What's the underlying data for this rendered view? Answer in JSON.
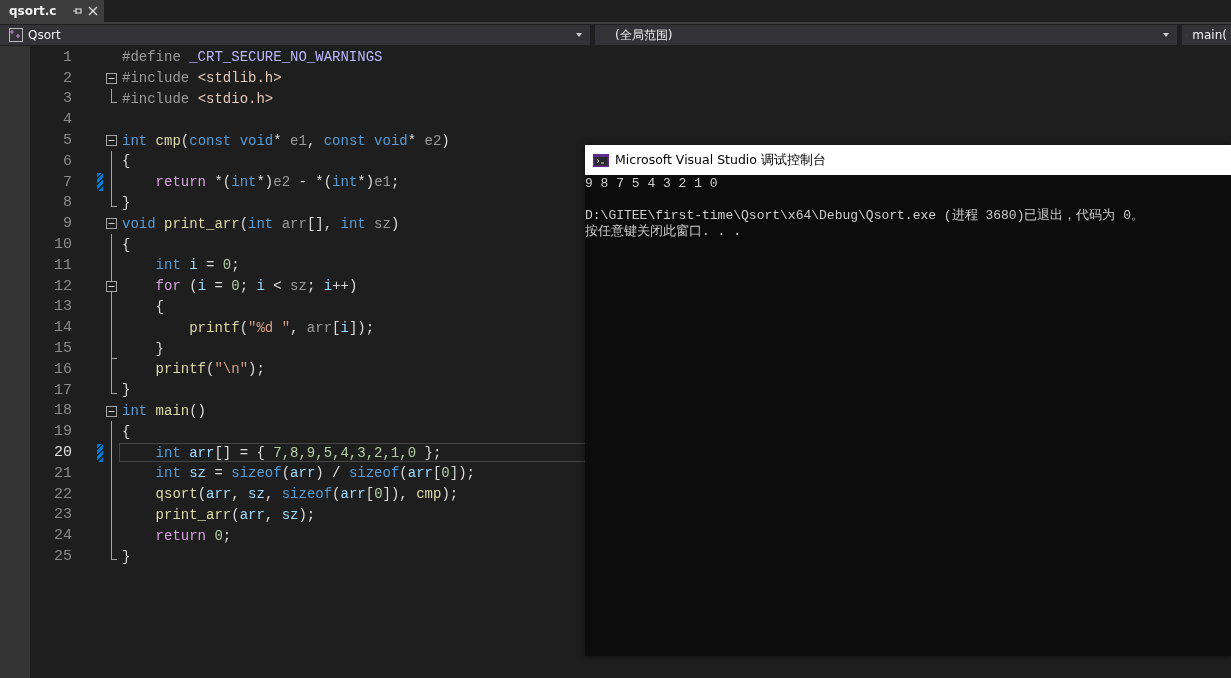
{
  "tabs": [
    {
      "label": "qsort.c",
      "selected": true
    }
  ],
  "navigation_bar": {
    "project": "Qsort",
    "scope": "(全局范围)",
    "member": "main("
  },
  "editor": {
    "lines": [
      {
        "number": "1",
        "collapsible": false,
        "in_region": false,
        "region_end": false,
        "changed": false,
        "current": false,
        "code": [
          {
            "kind": "preprocessor",
            "text": "#define "
          },
          {
            "kind": "macro",
            "text": "_CRT_SECURE_NO_WARNINGS"
          }
        ]
      },
      {
        "number": "2",
        "collapsible": true,
        "in_region": false,
        "region_end": false,
        "changed": false,
        "current": false,
        "code": [
          {
            "kind": "preprocessor",
            "text": "#include "
          },
          {
            "kind": "include",
            "text": "<stdlib.h>"
          }
        ]
      },
      {
        "number": "3",
        "collapsible": false,
        "in_region": false,
        "region_end": true,
        "changed": false,
        "current": false,
        "code": [
          {
            "kind": "preprocessor",
            "text": "#include "
          },
          {
            "kind": "include",
            "text": "<stdio.h>"
          }
        ]
      },
      {
        "number": "4",
        "collapsible": false,
        "in_region": false,
        "region_end": false,
        "changed": false,
        "current": false
      },
      {
        "number": "5",
        "collapsible": true,
        "in_region": false,
        "region_end": false,
        "changed": false,
        "current": false,
        "code": [
          {
            "kind": "keyword",
            "text": "int "
          },
          {
            "kind": "function",
            "text": "cmp"
          },
          {
            "kind": "plain",
            "text": "("
          },
          {
            "kind": "keyword",
            "text": "const void"
          },
          {
            "kind": "plain",
            "text": "* "
          },
          {
            "kind": "parameter",
            "text": "e1"
          },
          {
            "kind": "plain",
            "text": ", "
          },
          {
            "kind": "keyword",
            "text": "const void"
          },
          {
            "kind": "plain",
            "text": "* "
          },
          {
            "kind": "parameter",
            "text": "e2"
          },
          {
            "kind": "plain",
            "text": ")"
          }
        ]
      },
      {
        "number": "6",
        "collapsible": false,
        "in_region": true,
        "region_end": false,
        "changed": false,
        "current": false,
        "code": [
          {
            "kind": "plain",
            "text": "{"
          }
        ]
      },
      {
        "number": "7",
        "collapsible": false,
        "in_region": true,
        "region_end": false,
        "changed": true,
        "current": false,
        "code": [
          {
            "kind": "control",
            "text": "    return"
          },
          {
            "kind": "plain",
            "text": " *("
          },
          {
            "kind": "keyword",
            "text": "int"
          },
          {
            "kind": "plain",
            "text": "*)"
          },
          {
            "kind": "parameter",
            "text": "e2"
          },
          {
            "kind": "plain",
            "text": " - *("
          },
          {
            "kind": "keyword",
            "text": "int"
          },
          {
            "kind": "plain",
            "text": "*)"
          },
          {
            "kind": "parameter",
            "text": "e1"
          },
          {
            "kind": "plain",
            "text": ";"
          }
        ]
      },
      {
        "number": "8",
        "collapsible": false,
        "in_region": false,
        "region_end": true,
        "changed": false,
        "current": false,
        "code": [
          {
            "kind": "plain",
            "text": "}"
          }
        ]
      },
      {
        "number": "9",
        "collapsible": true,
        "in_region": false,
        "region_end": false,
        "changed": false,
        "current": false,
        "code": [
          {
            "kind": "keyword",
            "text": "void "
          },
          {
            "kind": "function",
            "text": "print_arr"
          },
          {
            "kind": "plain",
            "text": "("
          },
          {
            "kind": "keyword",
            "text": "int "
          },
          {
            "kind": "parameter",
            "text": "arr"
          },
          {
            "kind": "plain",
            "text": "[], "
          },
          {
            "kind": "keyword",
            "text": "int "
          },
          {
            "kind": "parameter",
            "text": "sz"
          },
          {
            "kind": "plain",
            "text": ")"
          }
        ]
      },
      {
        "number": "10",
        "collapsible": false,
        "in_region": true,
        "region_end": false,
        "changed": false,
        "current": false,
        "code": [
          {
            "kind": "plain",
            "text": "{"
          }
        ]
      },
      {
        "number": "11",
        "collapsible": false,
        "in_region": true,
        "region_end": false,
        "changed": false,
        "current": false,
        "code": [
          {
            "kind": "keyword",
            "text": "    int "
          },
          {
            "kind": "local",
            "text": "i"
          },
          {
            "kind": "plain",
            "text": " = "
          },
          {
            "kind": "number",
            "text": "0"
          },
          {
            "kind": "plain",
            "text": ";"
          }
        ]
      },
      {
        "number": "12",
        "collapsible": true,
        "in_region": true,
        "region_end": false,
        "changed": false,
        "current": false,
        "code": [
          {
            "kind": "control",
            "text": "    for"
          },
          {
            "kind": "plain",
            "text": " ("
          },
          {
            "kind": "local",
            "text": "i"
          },
          {
            "kind": "plain",
            "text": " = "
          },
          {
            "kind": "number",
            "text": "0"
          },
          {
            "kind": "plain",
            "text": "; "
          },
          {
            "kind": "local",
            "text": "i"
          },
          {
            "kind": "plain",
            "text": " < "
          },
          {
            "kind": "parameter",
            "text": "sz"
          },
          {
            "kind": "plain",
            "text": "; "
          },
          {
            "kind": "local",
            "text": "i"
          },
          {
            "kind": "plain",
            "text": "++)"
          }
        ]
      },
      {
        "number": "13",
        "collapsible": false,
        "in_region": true,
        "region_end": false,
        "changed": false,
        "current": false,
        "code": [
          {
            "kind": "plain",
            "text": "    {"
          }
        ]
      },
      {
        "number": "14",
        "collapsible": false,
        "in_region": true,
        "region_end": false,
        "changed": false,
        "current": false,
        "code": [
          {
            "kind": "function",
            "text": "        printf"
          },
          {
            "kind": "plain",
            "text": "("
          },
          {
            "kind": "string",
            "text": "\"%d \""
          },
          {
            "kind": "plain",
            "text": ", "
          },
          {
            "kind": "parameter",
            "text": "arr"
          },
          {
            "kind": "plain",
            "text": "["
          },
          {
            "kind": "local",
            "text": "i"
          },
          {
            "kind": "plain",
            "text": "]);"
          }
        ]
      },
      {
        "number": "15",
        "collapsible": false,
        "in_region": true,
        "region_end": true,
        "changed": false,
        "current": false,
        "code": [
          {
            "kind": "plain",
            "text": "    }"
          }
        ]
      },
      {
        "number": "16",
        "collapsible": false,
        "in_region": true,
        "region_end": false,
        "changed": false,
        "current": false,
        "code": [
          {
            "kind": "function",
            "text": "    printf"
          },
          {
            "kind": "plain",
            "text": "("
          },
          {
            "kind": "string",
            "text": "\"\\n\""
          },
          {
            "kind": "plain",
            "text": ");"
          }
        ]
      },
      {
        "number": "17",
        "collapsible": false,
        "in_region": false,
        "region_end": true,
        "changed": false,
        "current": false,
        "code": [
          {
            "kind": "plain",
            "text": "}"
          }
        ]
      },
      {
        "number": "18",
        "collapsible": true,
        "in_region": false,
        "region_end": false,
        "changed": false,
        "current": false,
        "code": [
          {
            "kind": "keyword",
            "text": "int "
          },
          {
            "kind": "function",
            "text": "main"
          },
          {
            "kind": "plain",
            "text": "()"
          }
        ]
      },
      {
        "number": "19",
        "collapsible": false,
        "in_region": true,
        "region_end": false,
        "changed": false,
        "current": false,
        "code": [
          {
            "kind": "plain",
            "text": "{"
          }
        ]
      },
      {
        "number": "20",
        "collapsible": false,
        "in_region": true,
        "region_end": false,
        "changed": true,
        "current": true,
        "code": [
          {
            "kind": "keyword",
            "text": "    int "
          },
          {
            "kind": "local",
            "text": "arr"
          },
          {
            "kind": "plain",
            "text": "[] = { "
          },
          {
            "kind": "number",
            "text": "7,8,9,5,4,3,2,1,0"
          },
          {
            "kind": "plain",
            "text": " };"
          }
        ]
      },
      {
        "number": "21",
        "collapsible": false,
        "in_region": true,
        "region_end": false,
        "changed": false,
        "current": false,
        "code": [
          {
            "kind": "keyword",
            "text": "    int "
          },
          {
            "kind": "local",
            "text": "sz"
          },
          {
            "kind": "plain",
            "text": " = "
          },
          {
            "kind": "keyword",
            "text": "sizeof"
          },
          {
            "kind": "plain",
            "text": "("
          },
          {
            "kind": "local",
            "text": "arr"
          },
          {
            "kind": "plain",
            "text": ") / "
          },
          {
            "kind": "keyword",
            "text": "sizeof"
          },
          {
            "kind": "plain",
            "text": "("
          },
          {
            "kind": "local",
            "text": "arr"
          },
          {
            "kind": "plain",
            "text": "["
          },
          {
            "kind": "number",
            "text": "0"
          },
          {
            "kind": "plain",
            "text": "]);"
          }
        ]
      },
      {
        "number": "22",
        "collapsible": false,
        "in_region": true,
        "region_end": false,
        "changed": false,
        "current": false,
        "code": [
          {
            "kind": "function",
            "text": "    qsort"
          },
          {
            "kind": "plain",
            "text": "("
          },
          {
            "kind": "local",
            "text": "arr"
          },
          {
            "kind": "plain",
            "text": ", "
          },
          {
            "kind": "local",
            "text": "sz"
          },
          {
            "kind": "plain",
            "text": ", "
          },
          {
            "kind": "keyword",
            "text": "sizeof"
          },
          {
            "kind": "plain",
            "text": "("
          },
          {
            "kind": "local",
            "text": "arr"
          },
          {
            "kind": "plain",
            "text": "["
          },
          {
            "kind": "number",
            "text": "0"
          },
          {
            "kind": "plain",
            "text": "]), "
          },
          {
            "kind": "function",
            "text": "cmp"
          },
          {
            "kind": "plain",
            "text": ");"
          }
        ]
      },
      {
        "number": "23",
        "collapsible": false,
        "in_region": true,
        "region_end": false,
        "changed": false,
        "current": false,
        "code": [
          {
            "kind": "function",
            "text": "    print_arr"
          },
          {
            "kind": "plain",
            "text": "("
          },
          {
            "kind": "local",
            "text": "arr"
          },
          {
            "kind": "plain",
            "text": ", "
          },
          {
            "kind": "local",
            "text": "sz"
          },
          {
            "kind": "plain",
            "text": ");"
          }
        ]
      },
      {
        "number": "24",
        "collapsible": false,
        "in_region": true,
        "region_end": false,
        "changed": false,
        "current": false,
        "code": [
          {
            "kind": "control",
            "text": "    return "
          },
          {
            "kind": "number",
            "text": "0"
          },
          {
            "kind": "plain",
            "text": ";"
          }
        ]
      },
      {
        "number": "25",
        "collapsible": false,
        "in_region": false,
        "region_end": true,
        "changed": false,
        "current": false,
        "code": [
          {
            "kind": "plain",
            "text": "}"
          }
        ]
      }
    ]
  },
  "console": {
    "title": "Microsoft Visual Studio 调试控制台",
    "program_output": [
      "9 8 7 5 4 3 2 1 0"
    ],
    "exit_message": [
      "D:\\GITEE\\first-time\\Qsort\\x64\\Debug\\Qsort.exe (进程 3680)已退出，代码为 0。",
      "按任意键关闭此窗口. . ."
    ]
  }
}
